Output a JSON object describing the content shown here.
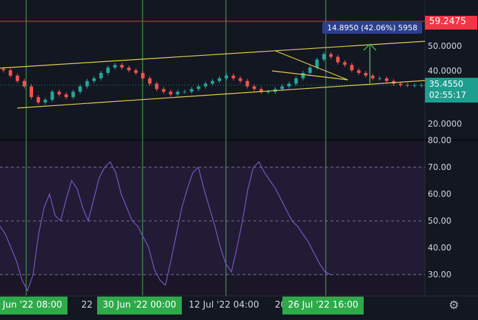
{
  "price_axis": {
    "high_badge": "59.2475",
    "last_price": "35.4550",
    "countdown": "02:55:17",
    "tick_labels": [
      "50.0000",
      "40.0000",
      "20.0000"
    ]
  },
  "measure_tool": {
    "label": "14.8950 (42.06%) 5958"
  },
  "rsi_axis": {
    "tick_labels": [
      "80.00",
      "70.00",
      "60.00",
      "50.00",
      "40.00",
      "30.00"
    ]
  },
  "time_axis": {
    "highlight_1": "Jun '22   08:00",
    "plain_1": "22",
    "highlight_2": "30 Jun '22   00:00",
    "plain_2": "12 Jul '22   04:00",
    "plain_3": "20",
    "highlight_3": "26 Jul '22   16:00"
  },
  "colors": {
    "background": "#131722",
    "candles_up": "#26a69a",
    "candles_down": "#ef5350",
    "channel": "#e8d44d",
    "vertical_lines": "#4caf50",
    "high_line": "#f23645",
    "rsi_line": "#7e57c2",
    "time_highlight": "#2eaa4a"
  },
  "chart_data": [
    {
      "type": "line",
      "name": "price",
      "ylim": [
        15,
        60
      ],
      "x": [
        0,
        1,
        2,
        3,
        4,
        5,
        6,
        7,
        8,
        9,
        10,
        11,
        12,
        13,
        14,
        15,
        16,
        17,
        18,
        19,
        20,
        21,
        22,
        23,
        24,
        25,
        26,
        27,
        28,
        29,
        30,
        31,
        32,
        33,
        34,
        35,
        36,
        37,
        38,
        39,
        40,
        41,
        42,
        43,
        44,
        45,
        46,
        47,
        48,
        49,
        50,
        51,
        52,
        53,
        54,
        55,
        56,
        57,
        58,
        59,
        60
      ],
      "close": [
        41,
        39,
        37,
        35,
        31,
        29,
        30,
        33,
        32,
        31,
        33,
        35,
        37,
        38,
        40,
        42,
        43,
        42,
        41,
        40,
        38,
        36,
        34,
        33,
        32,
        33,
        33,
        34,
        35,
        36,
        37,
        38,
        39,
        38,
        37,
        35,
        34,
        33,
        33,
        34,
        35,
        36,
        38,
        40,
        42,
        45,
        47,
        46,
        44,
        43,
        41,
        40,
        39,
        38,
        38,
        37,
        36,
        35.5,
        35.4,
        35.4,
        35.455
      ],
      "high_line": 59.2475,
      "last": 35.455
    },
    {
      "type": "line",
      "name": "rsi",
      "ylim": [
        20,
        80
      ],
      "levels": [
        70,
        50,
        30
      ],
      "values": [
        48,
        45,
        40,
        35,
        28,
        24,
        30,
        45,
        55,
        60,
        52,
        50,
        58,
        65,
        62,
        55,
        50,
        58,
        66,
        70,
        72,
        68,
        60,
        55,
        50,
        48,
        44,
        40,
        32,
        28,
        26,
        35,
        45,
        55,
        62,
        68,
        70,
        62,
        55,
        48,
        40,
        34,
        31,
        40,
        50,
        62,
        70,
        72,
        68,
        65,
        62,
        58,
        54,
        50,
        48,
        45,
        42,
        38,
        34,
        31,
        30
      ]
    }
  ]
}
